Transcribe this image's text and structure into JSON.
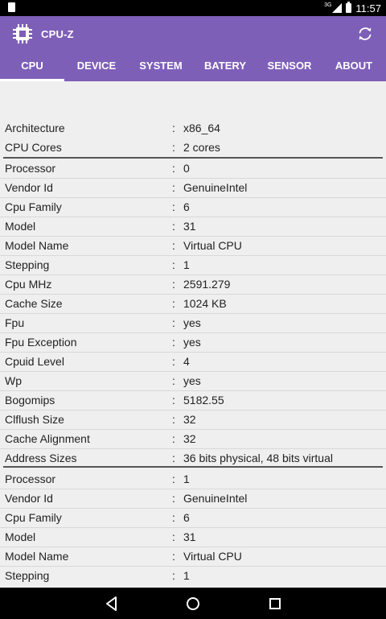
{
  "status_bar": {
    "network": "3G",
    "time": "11:57"
  },
  "app": {
    "title": "CPU-Z",
    "icon": "chip-icon",
    "refresh_icon": "refresh-icon",
    "accent_color": "#7e5fb8"
  },
  "tabs": [
    {
      "label": "CPU",
      "active": true
    },
    {
      "label": "DEVICE",
      "active": false
    },
    {
      "label": "SYSTEM",
      "active": false
    },
    {
      "label": "BATERY",
      "active": false
    },
    {
      "label": "SENSOR",
      "active": false
    },
    {
      "label": "ABOUT",
      "active": false
    }
  ],
  "rows": [
    {
      "key": "Architecture",
      "value": "x86_64"
    },
    {
      "key": "CPU Cores",
      "value": "2 cores"
    },
    {
      "key": "Processor",
      "value": "0"
    },
    {
      "key": "Vendor Id",
      "value": "GenuineIntel"
    },
    {
      "key": "Cpu Family",
      "value": "6"
    },
    {
      "key": "Model",
      "value": "31"
    },
    {
      "key": "Model Name",
      "value": "Virtual CPU"
    },
    {
      "key": "Stepping",
      "value": "1"
    },
    {
      "key": "Cpu MHz",
      "value": "2591.279"
    },
    {
      "key": "Cache Size",
      "value": "1024 KB"
    },
    {
      "key": "Fpu",
      "value": "yes"
    },
    {
      "key": "Fpu Exception",
      "value": "yes"
    },
    {
      "key": "Cpuid Level",
      "value": "4"
    },
    {
      "key": "Wp",
      "value": "yes"
    },
    {
      "key": "Bogomips",
      "value": "5182.55"
    },
    {
      "key": "Clflush Size",
      "value": "32"
    },
    {
      "key": "Cache Alignment",
      "value": "32"
    },
    {
      "key": "Address Sizes",
      "value": "36 bits physical, 48 bits virtual"
    },
    {
      "key": "Processor",
      "value": "1"
    },
    {
      "key": "Vendor Id",
      "value": "GenuineIntel"
    },
    {
      "key": "Cpu Family",
      "value": "6"
    },
    {
      "key": "Model",
      "value": "31"
    },
    {
      "key": "Model Name",
      "value": "Virtual CPU"
    },
    {
      "key": "Stepping",
      "value": "1"
    }
  ],
  "nav": {
    "back": "back-icon",
    "home": "home-icon",
    "recents": "recents-icon"
  }
}
